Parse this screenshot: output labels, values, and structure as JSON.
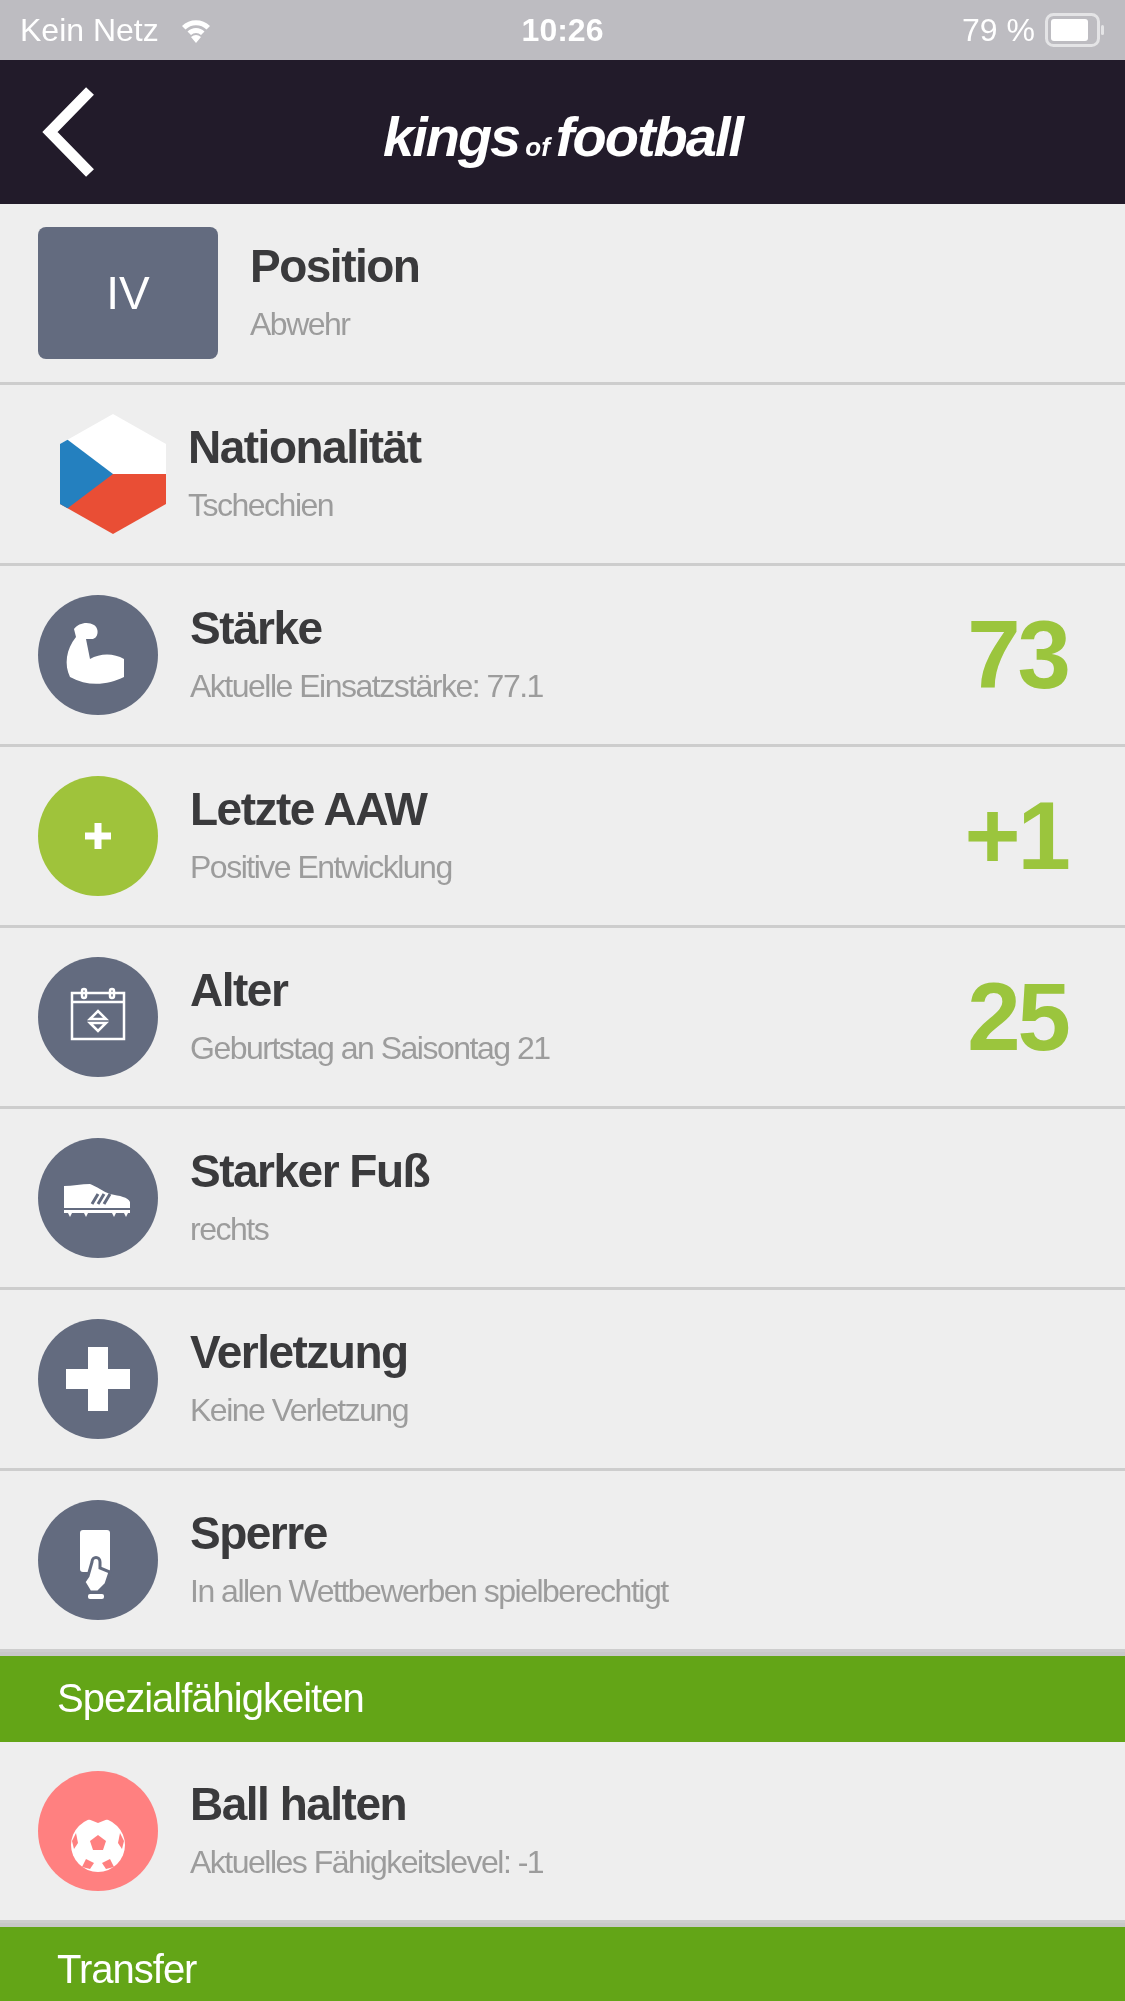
{
  "status_bar": {
    "carrier": "Kein Netz",
    "time": "10:26",
    "battery": "79 %"
  },
  "nav": {
    "logo": [
      "kings",
      "of",
      "football"
    ]
  },
  "sections": [
    {
      "rows": [
        {
          "kind": "badge",
          "badge": "IV",
          "title": "Position",
          "subtitle": "Abwehr"
        },
        {
          "kind": "flag",
          "title": "Nationalität",
          "subtitle": "Tschechien"
        },
        {
          "kind": "circle",
          "color": "#636b7f",
          "title": "Stärke",
          "subtitle": "Aktuelle Einsatzstärke: 77.1",
          "value": "73"
        },
        {
          "kind": "circle",
          "color": "#9fc33b",
          "title": "Letzte AAW",
          "subtitle": "Positive Entwicklung",
          "value": "+1"
        },
        {
          "kind": "circle",
          "color": "#636b7f",
          "title": "Alter",
          "subtitle": "Geburtstag an Saisontag 21",
          "value": "25"
        },
        {
          "kind": "circle",
          "color": "#636b7f",
          "title": "Starker Fuß",
          "subtitle": "rechts"
        },
        {
          "kind": "circle",
          "color": "#636b7f",
          "title": "Verletzung",
          "subtitle": "Keine Verletzung"
        },
        {
          "kind": "circle",
          "color": "#636b7f",
          "title": "Sperre",
          "subtitle": "In allen Wettbewerben spielberechtigt"
        }
      ]
    },
    {
      "header": "Spezialfähigkeiten",
      "rows": [
        {
          "kind": "circle",
          "color": "#ff8080",
          "title": "Ball halten",
          "subtitle": "Aktuelles Fähigkeitslevel: -1"
        }
      ]
    },
    {
      "header": "Transfer"
    }
  ]
}
